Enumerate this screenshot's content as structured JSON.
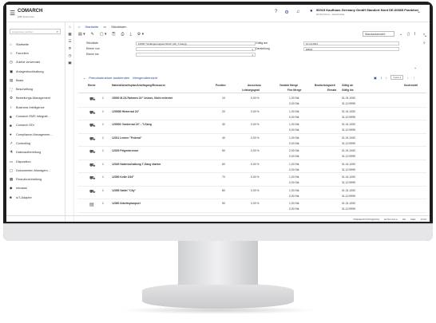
{
  "app": {
    "logo": "COMARCH",
    "logo_sub": "ERP Enterprise",
    "user_name": "90015 Kaufhaus Germany GmbH Standort Nord DE-60865 Frankfurt",
    "user_sub": "ECSA-KKLA - Javachristel"
  },
  "topbar_icons": [
    "help-icon",
    "settings-icon",
    "notification-icon"
  ],
  "sidebar": {
    "search_placeholder": "Anwendung suchen",
    "items": [
      {
        "label": "Startseite",
        "icon": "home-icon",
        "glyph": "⌂"
      },
      {
        "label": "Favoriten",
        "icon": "star-icon",
        "glyph": "☆"
      },
      {
        "label": "Zuletzt verwendet",
        "icon": "history-icon",
        "glyph": "◷"
      },
      {
        "label": "Anlagenbuchhaltung",
        "icon": "asset-icon",
        "glyph": "▣"
      },
      {
        "label": "Basis",
        "icon": "basis-icon",
        "glyph": "▤"
      },
      {
        "label": "Beschaffung",
        "icon": "procurement-icon",
        "glyph": "⛶"
      },
      {
        "label": "Bestellungs-Management",
        "icon": "orders-icon",
        "glyph": "⚙"
      },
      {
        "label": "Business Intelligence",
        "icon": "bi-icon",
        "glyph": "♀"
      },
      {
        "label": "Comarch EMS Integrati...",
        "icon": "ems-icon",
        "glyph": "■"
      },
      {
        "label": "Comarch EDI",
        "icon": "edi-icon",
        "glyph": "■"
      },
      {
        "label": "Compliance-Managemen...",
        "icon": "compliance-icon",
        "glyph": "●"
      },
      {
        "label": "Controlling",
        "icon": "controlling-icon",
        "glyph": "↗"
      },
      {
        "label": "Datenaufbereitung",
        "icon": "data-icon",
        "glyph": "⚗"
      },
      {
        "label": "Disposition",
        "icon": "disposition-icon",
        "glyph": "▭"
      },
      {
        "label": "Dokumenten-Managem...",
        "icon": "document-icon",
        "glyph": "▢"
      },
      {
        "label": "Finanzbuchhaltung",
        "icon": "finance-icon",
        "glyph": "▦"
      },
      {
        "label": "Intrastat",
        "icon": "intrastat-icon",
        "glyph": "◆"
      },
      {
        "label": "IoT-Adapter",
        "icon": "iot-icon",
        "glyph": "■"
      }
    ]
  },
  "breadcrumb": {
    "home": "Startseite",
    "current": "Stücklisten"
  },
  "right_tools": {
    "view_select": "Standardansicht"
  },
  "form": {
    "stueckliste_label": "Stückliste",
    "stueckliste_value": "10000 \"Verlängerungsset Wind\" (AF_T-Gang)",
    "gueltig_label": "Gültig am",
    "gueltig_value": "10.12.2021",
    "ebene_von_label": "Ebene von",
    "ebene_von_value": "1",
    "darstellung_label": "Darstellung",
    "darstellung_value": "ERM2",
    "ebene_bis_label": "Ebene bis",
    "ebene_bis_value": "1"
  },
  "panel": {
    "tab_all": "Pseudostrukture ausblenden",
    "tab_menge": "Mengenübersicht",
    "pager": "1 von 1"
  },
  "table": {
    "headers": {
      "ebene": "Ebene",
      "material": "Material/Arbeitsplan/Arbeitsgang/Ressource",
      "position": "Position",
      "ausschuss": "Ausschuss",
      "leistungsgrad": "Leistungsgrad",
      "var_menge": "Variable Menge",
      "fixe_menge": "Fixe Menge",
      "bearbeitung": "Bearbeitungszeit",
      "einsatz": "Einsatz",
      "gueltig_ab": "Gültig ab",
      "gueltig_bis": "Gültig bis",
      "kosten": "Kostenstell"
    },
    "rows": [
      {
        "ebene": "1",
        "material": "15000 M.ZA Rahmen 24\" Unisex, Nicht entiretet",
        "position": "10",
        "ausschuss": "0,00 %",
        "var": "1,00 Stk",
        "fix": "0,00 Stk",
        "ab": "01.01.1000",
        "bis": "31.12.9999"
      },
      {
        "ebene": "1",
        "material": "12000B Hinterrad 24\"",
        "position": "20",
        "ausschuss": "0,00 %",
        "var": "1,00 Stk",
        "fix": "0,00 Stk",
        "ab": "01.01.1000",
        "bis": "31.12.9999"
      },
      {
        "ebene": "1",
        "material": "12000D Vorderrad 24\" - T-Gang",
        "position": "30",
        "ausschuss": "0,00 %",
        "var": "1,00 Stk",
        "fix": "0,00 Stk",
        "ab": "01.01.1000",
        "bis": "31.12.9999"
      },
      {
        "ebene": "1",
        "material": "12011 Lenker \"Federal\"",
        "position": "40",
        "ausschuss": "0,00 %",
        "var": "1,00 Stk",
        "fix": "0,00 Stk",
        "ab": "01.01.1000",
        "bis": "31.12.9999"
      },
      {
        "ebene": "1",
        "material": "12029 Felgenbremse",
        "position": "50",
        "ausschuss": "0,00 %",
        "var": "2,00 Stk",
        "fix": "0,00 Stk",
        "ab": "01.01.1000",
        "bis": "31.12.9999"
      },
      {
        "ebene": "1",
        "material": "12040 Nabenschaltung T-Gang starker",
        "position": "60",
        "ausschuss": "0,00 %",
        "var": "1,00 Stk",
        "fix": "0,00 Stk",
        "ab": "01.01.1000",
        "bis": "31.12.9999"
      },
      {
        "ebene": "1",
        "material": "12050 Kette 3/16\"",
        "position": "70",
        "ausschuss": "0,00 %",
        "var": "1,00 Stk",
        "fix": "0,00 Stk",
        "ab": "01.01.1000",
        "bis": "31.12.9999"
      },
      {
        "ebene": "1",
        "material": "12055 Sattel \"City\"",
        "position": "80",
        "ausschuss": "0,00 %",
        "var": "1,00 Stk",
        "fix": "0,00 Stk",
        "ab": "01.01.1000",
        "bis": "31.12.9999"
      },
      {
        "ebene": "1",
        "material": "12060 Arbeitsplanpsel",
        "position": "90",
        "ausschuss": "0,00 %",
        "var": "1,00 Stk",
        "fix": "0,00 Stk",
        "ab": "01.01.1000",
        "bis": "31.12.9999"
      }
    ]
  },
  "statusbar": {
    "a": "PRESENTATION@0001",
    "b": "ECSA-KKLA",
    "c": "DE",
    "d": "MEZ",
    "e": "15:00"
  }
}
